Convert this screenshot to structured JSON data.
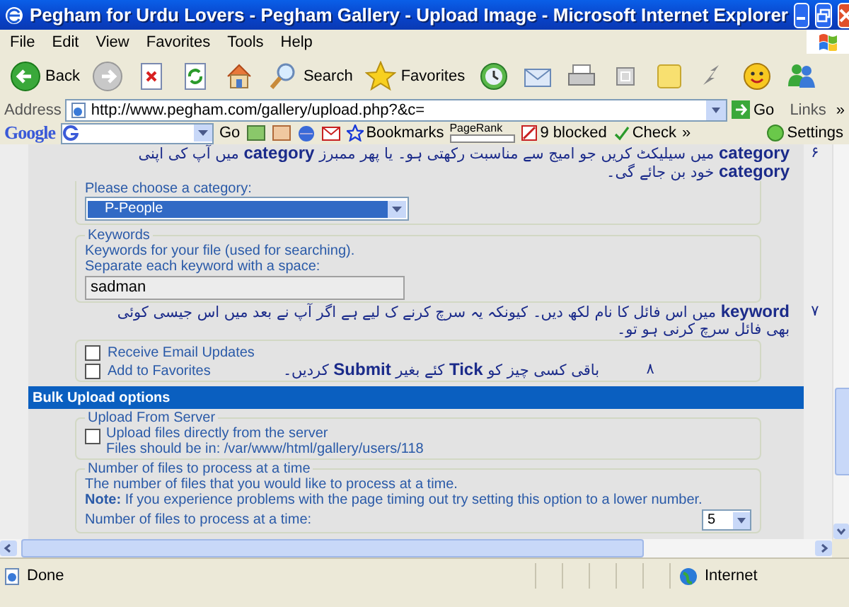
{
  "window": {
    "title": "Pegham for Urdu Lovers - Pegham Gallery - Upload Image - Microsoft Internet Explorer"
  },
  "menu": [
    "File",
    "Edit",
    "View",
    "Favorites",
    "Tools",
    "Help"
  ],
  "toolbar": [
    {
      "kind": "back",
      "label": "Back"
    },
    {
      "kind": "forward"
    },
    {
      "kind": "stop"
    },
    {
      "kind": "refresh"
    },
    {
      "kind": "home"
    },
    {
      "kind": "search",
      "label": "Search"
    },
    {
      "kind": "favorites",
      "label": "Favorites"
    },
    {
      "kind": "history"
    },
    {
      "kind": "mail"
    },
    {
      "kind": "print"
    },
    {
      "kind": "edit"
    },
    {
      "kind": "note"
    },
    {
      "kind": "bolt"
    },
    {
      "kind": "smiley"
    },
    {
      "kind": "messenger"
    }
  ],
  "address_bar": {
    "label": "Address",
    "url": "http://www.pegham.com/gallery/upload.php?&c=",
    "go": "Go",
    "links": "Links",
    "more": "»"
  },
  "google_toolbar": {
    "logo": "Google",
    "go": "Go",
    "bookmarks": "Bookmarks",
    "pagerank": "PageRank",
    "blocked": "9 blocked",
    "check": "Check",
    "more": "»",
    "settings": "Settings"
  },
  "form": {
    "category": {
      "hint": "Please choose a category:",
      "value": "P-People"
    },
    "keywords": {
      "legend": "Keywords",
      "help": [
        "Keywords for your file (used for searching).",
        "Separate each keyword with a space:"
      ],
      "value": "sadman"
    },
    "options": [
      {
        "label": "Receive Email Updates",
        "checked": false
      },
      {
        "label": "Add to Favorites",
        "checked": false
      }
    ],
    "bulk_header": "Bulk Upload options",
    "upload_server": {
      "legend": "Upload From Server",
      "checked": false,
      "label": "Upload files directly from the server",
      "path": "Files should be in: /var/www/html/gallery/users/118"
    },
    "files_at_time": {
      "legend": "Number of files to process at a time",
      "text": "The number of files that you would like to process at a time.",
      "note": "**Note:** If you experience problems with the page timing out try setting this option to a lower number.",
      "label": "Number of files to process at a time:",
      "value": "5"
    }
  },
  "annotations": [
    {
      "number": "۶",
      "text": "**category** میں سیلیکٹ کریں جو امیج سے مناسبت رکھتی ہو۔ یا پھر ممبرز **category** میں آپ کی اپنی **category** خود بن جائے گی۔"
    },
    {
      "number": "۷",
      "text": "**keyword** میں اس فائل کا نام لکھ دیں۔ کیونکہ یہ سرچ کرنے ک لیے ہے اگر آپ نے بعد میں اس جیسی کوئی بھی فائل سرچ کرنی ہو تو۔"
    },
    {
      "number": "۸",
      "text": "باقی کسی چیز کو **Tick** کئے بغیر **Submit** کردیں۔"
    }
  ],
  "status_bar": {
    "text": "Done",
    "zone": "Internet"
  }
}
